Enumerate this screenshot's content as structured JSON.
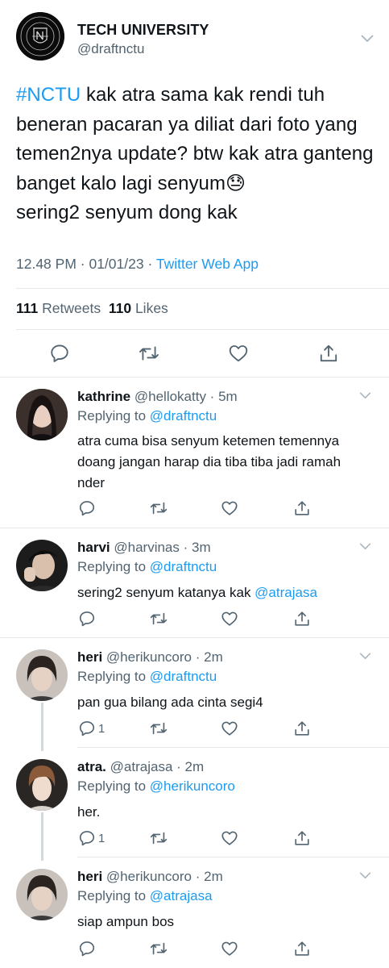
{
  "main_tweet": {
    "display_name": "TECH UNIVERSITY",
    "handle": "@draftnctu",
    "avatar": "nct-crest-logo",
    "hashtag": "#NCTU",
    "text": " kak atra sama kak rendi tuh beneran pacaran ya diliat dari foto yang temen2nya update? btw kak atra ganteng banget kalo lagi senyum",
    "emoji": "😓",
    "text_end": "sering2 senyum dong kak",
    "time": "12.48 PM",
    "date": "01/01/23",
    "separator": " · ",
    "source": "Twitter Web App",
    "retweets_count": "111",
    "retweets_label": "Retweets",
    "likes_count": "110",
    "likes_label": "Likes",
    "actions": [
      "reply-icon",
      "retweet-icon",
      "like-icon",
      "share-icon"
    ]
  },
  "replies": [
    {
      "name": "kathrine",
      "handle": "@hellokatty",
      "time": "5m",
      "replying_label": "Replying to",
      "replying_to": "@draftnctu",
      "text": "atra cuma bisa senyum ketemen temennya doang jangan harap dia tiba tiba jadi ramah nder",
      "mention": "",
      "reply_count": ""
    },
    {
      "name": "harvi",
      "handle": "@harvinas",
      "time": "3m",
      "replying_label": "Replying to",
      "replying_to": "@draftnctu",
      "text": "sering2 senyum katanya kak ",
      "mention": "@atrajasa",
      "reply_count": ""
    },
    {
      "name": "heri",
      "handle": "@herikuncoro",
      "time": "2m",
      "replying_label": "Replying to",
      "replying_to": "@draftnctu",
      "text": "pan gua bilang ada cinta segi4",
      "mention": "",
      "reply_count": "1"
    },
    {
      "name": "atra.",
      "handle": "@atrajasa",
      "time": "2m",
      "replying_label": "Replying to",
      "replying_to": "@herikuncoro",
      "text": "her.",
      "mention": "",
      "reply_count": "1"
    },
    {
      "name": "heri",
      "handle": "@herikuncoro",
      "time": "2m",
      "replying_label": "Replying to",
      "replying_to": "@atrajasa",
      "text": "siap ampun bos",
      "mention": "",
      "reply_count": ""
    }
  ],
  "colors": {
    "link": "#1d9bf0",
    "secondary_text": "#536471",
    "icon": "#536471",
    "thread_line": "#cfd9de"
  }
}
